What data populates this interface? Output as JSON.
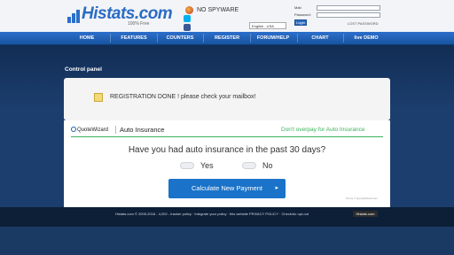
{
  "header": {
    "logo_text": "Histats.com",
    "logo_sub": "100% Free",
    "nospyware": "NO SPYWARE",
    "language": "English - USA",
    "login": {
      "mail_label": "Mail:",
      "password_label": "Password:",
      "login_button": "Login",
      "lost_password": "LOST PASSWORD"
    },
    "share_icons": [
      {
        "name": "skype-icon",
        "color": "#00aff0"
      },
      {
        "name": "facebook-icon",
        "color": "#3b5998"
      }
    ]
  },
  "nav": {
    "items": [
      "HOME",
      "FEATURES",
      "COUNTERS",
      "REGISTER",
      "FORUM/HELP",
      "CHART",
      "live DEMO"
    ]
  },
  "main": {
    "panel_title": "Control panel",
    "registration_message": "REGISTRATION DONE ! please check your mailbox!"
  },
  "ad": {
    "brand": "QuoteWizard",
    "title": "Auto Insurance",
    "tagline": "Don't overpay for Auto Insurance",
    "question": "Have you had auto insurance in the past 30 days?",
    "options": [
      "Yes",
      "No"
    ],
    "cta": "Calculate New Payment",
    "cta_arrow": "▸",
    "footnote": "Terms © QuoteWizard.com"
  },
  "footer": {
    "text": "Histats.com © 2005-2018 - 4,002 - tracker policy · Integrate your policy · this website PRIVACY POLICY · Check/do opt-out",
    "badge": "Histats.com"
  },
  "colors": {
    "accent": "#2b6cc4",
    "nav_top": "#2d6fcc",
    "background": "#1c3e6e",
    "green": "#3bb35a"
  }
}
